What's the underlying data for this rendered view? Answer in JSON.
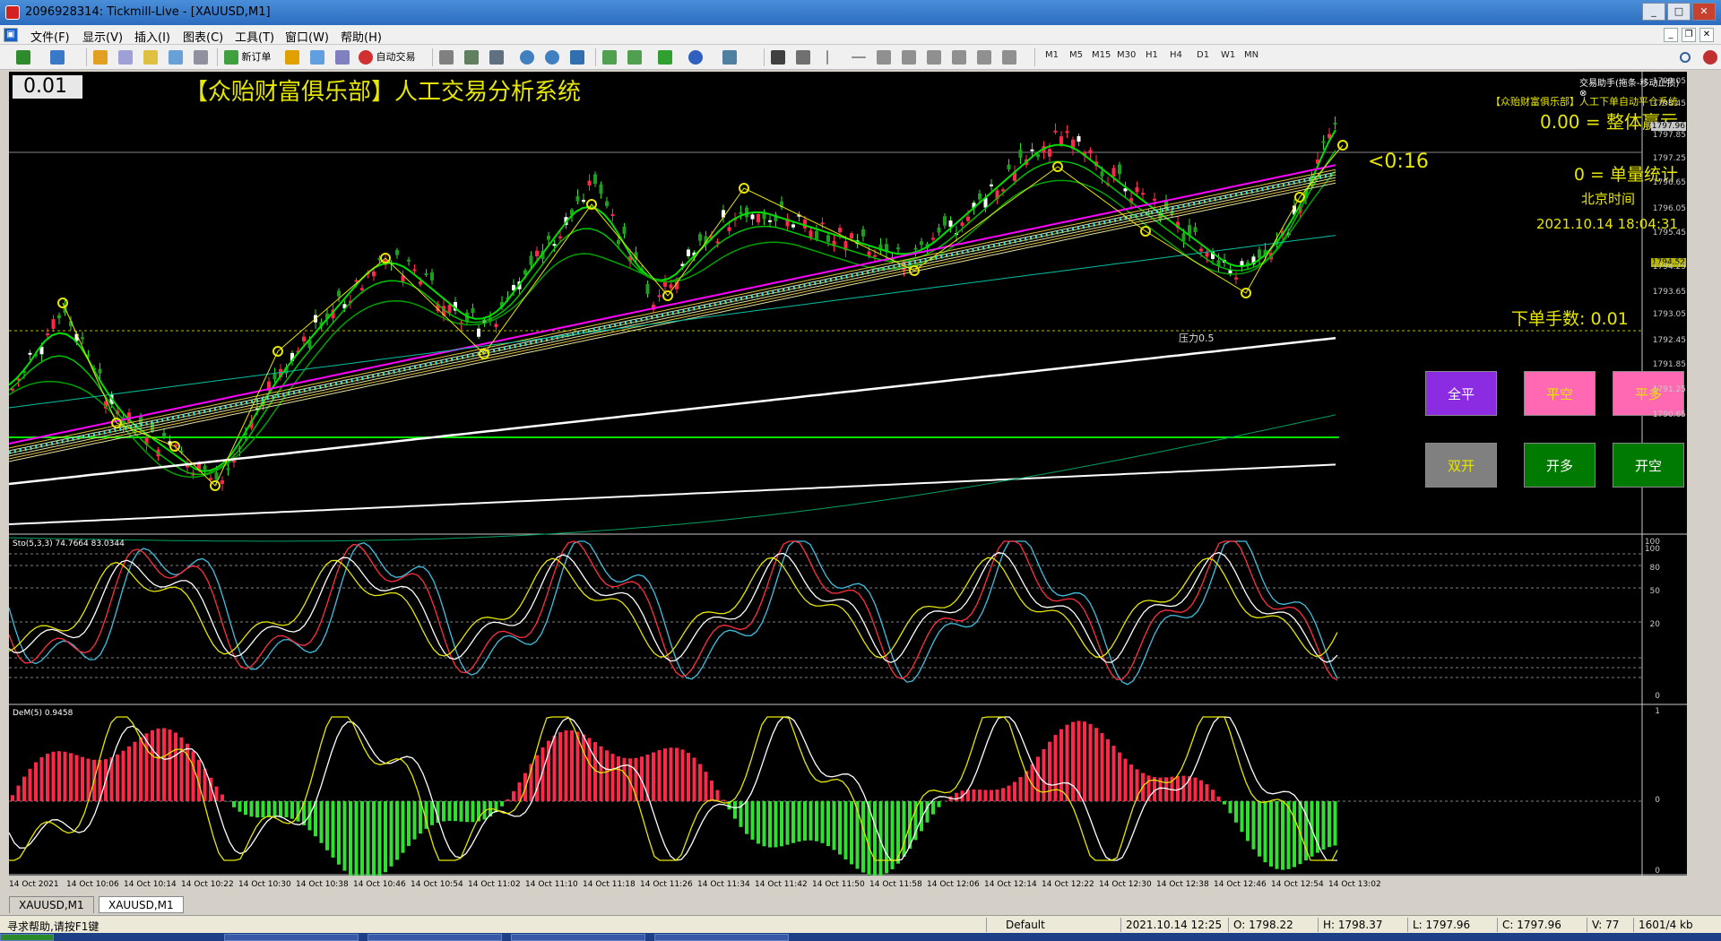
{
  "window": {
    "title": "2096928314: Tickmill-Live - [XAUUSD,M1]"
  },
  "menu": [
    "文件(F)",
    "显示(V)",
    "插入(I)",
    "图表(C)",
    "工具(T)",
    "窗口(W)",
    "帮助(H)"
  ],
  "toolbar": {
    "new_order": "新订单",
    "auto_trade": "自动交易",
    "timeframes": [
      "M1",
      "M5",
      "M15",
      "M30",
      "H1",
      "H4",
      "D1",
      "W1",
      "MN"
    ]
  },
  "overlay": {
    "lot_value": "0.01",
    "headline": "【众贻财富俱乐部】人工交易分析系统",
    "assistant": "交易助手(拖条-移动止损)",
    "system": "【众贻财富俱乐部】人工下单自动平仓系统",
    "profit": "0.00 = 整体赢亏",
    "timer": "<0:16",
    "single": "0 = 单量统计",
    "beijing_label": "北京时间",
    "beijing_time": "2021.10.14 18:04:31",
    "lots": "下单手数:  0.01",
    "pressure": "压力0.5"
  },
  "buttons": [
    {
      "label": "全平",
      "bg": "#8b2be2",
      "fg": "#ffffff"
    },
    {
      "label": "平空",
      "bg": "#ff69b4",
      "fg": "#e6e600"
    },
    {
      "label": "平多",
      "bg": "#ff69b4",
      "fg": "#e6e600"
    },
    {
      "label": "双开",
      "bg": "#808080",
      "fg": "#e6e600"
    },
    {
      "label": "开多",
      "bg": "#007a00",
      "fg": "#ffffff"
    },
    {
      "label": "开空",
      "bg": "#007a00",
      "fg": "#ffffff"
    }
  ],
  "price_axis": [
    "1799.05",
    "1798.45",
    "1797.96",
    "1797.85",
    "1797.25",
    "1796.65",
    "1796.05",
    "1795.45",
    "1794.52",
    "1794.25",
    "1793.65",
    "1793.05",
    "1792.45",
    "1791.85",
    "1791.25",
    "1790.65"
  ],
  "sto": {
    "label": "Sto(5,3,3) 74.7664 83.0344",
    "axis": [
      "100",
      "100",
      "80",
      "50",
      "20",
      "0"
    ]
  },
  "dem": {
    "label": "DeM(5) 0.9458",
    "axis": [
      "1",
      "0",
      "0"
    ]
  },
  "time_axis": [
    "14 Oct 2021",
    "14 Oct 10:06",
    "14 Oct 10:14",
    "14 Oct 10:22",
    "14 Oct 10:30",
    "14 Oct 10:38",
    "14 Oct 10:46",
    "14 Oct 10:54",
    "14 Oct 11:02",
    "14 Oct 11:10",
    "14 Oct 11:18",
    "14 Oct 11:26",
    "14 Oct 11:34",
    "14 Oct 11:42",
    "14 Oct 11:50",
    "14 Oct 11:58",
    "14 Oct 12:06",
    "14 Oct 12:14",
    "14 Oct 12:22",
    "14 Oct 12:30",
    "14 Oct 12:38",
    "14 Oct 12:46",
    "14 Oct 12:54",
    "14 Oct 13:02"
  ],
  "tabs": [
    "XAUUSD,M1",
    "XAUUSD,M1"
  ],
  "status": {
    "help": "寻求帮助,请按F1键",
    "profile": "Default",
    "datetime": "2021.10.14 12:25",
    "open": "O: 1798.22",
    "high": "H: 1798.37",
    "low": "L: 1797.96",
    "close": "C: 1797.96",
    "volume": "V: 77",
    "traffic": "1601/4 kb"
  }
}
